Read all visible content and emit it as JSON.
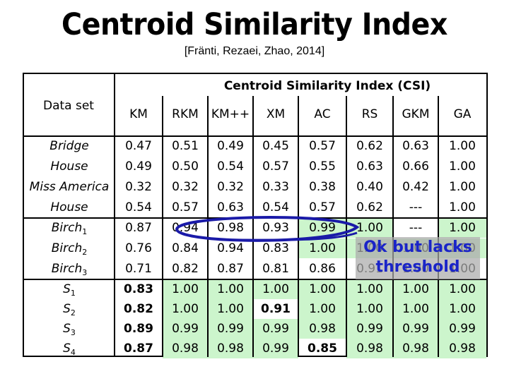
{
  "title": "Centroid Similarity Index",
  "citation": "[Fränti, Rezaei, Zhao, 2014]",
  "table": {
    "group_header": "Centroid Similarity Index (CSI)",
    "dataset_header": "Data set",
    "columns": [
      "KM",
      "RKM",
      "KM++",
      "XM",
      "AC",
      "RS",
      "GKM",
      "GA"
    ],
    "groups": [
      {
        "rows": [
          {
            "dataset": "Bridge",
            "sub": "",
            "values": [
              "0.47",
              "0.51",
              "0.49",
              "0.45",
              "0.57",
              "0.62",
              "0.63",
              "1.00"
            ]
          },
          {
            "dataset": "House",
            "sub": "",
            "values": [
              "0.49",
              "0.50",
              "0.54",
              "0.57",
              "0.55",
              "0.63",
              "0.66",
              "1.00"
            ]
          },
          {
            "dataset": "Miss America",
            "sub": "",
            "values": [
              "0.32",
              "0.32",
              "0.32",
              "0.33",
              "0.38",
              "0.40",
              "0.42",
              "1.00"
            ]
          },
          {
            "dataset": "House",
            "sub": "",
            "values": [
              "0.54",
              "0.57",
              "0.63",
              "0.54",
              "0.57",
              "0.62",
              "---",
              "1.00"
            ]
          }
        ]
      },
      {
        "rows": [
          {
            "dataset": "Birch",
            "sub": "1",
            "values": [
              "0.87",
              "0.94",
              "0.98",
              "0.93",
              "0.99",
              "1.00",
              "---",
              "1.00"
            ]
          },
          {
            "dataset": "Birch",
            "sub": "2",
            "values": [
              "0.76",
              "0.84",
              "0.94",
              "0.83",
              "1.00",
              "1.00",
              "1.00",
              "1.00"
            ]
          },
          {
            "dataset": "Birch",
            "sub": "3",
            "values": [
              "0.71",
              "0.82",
              "0.87",
              "0.81",
              "0.86",
              "0.91",
              "1.00",
              "1.00"
            ]
          }
        ]
      },
      {
        "rows": [
          {
            "dataset": "S",
            "sub": "1",
            "values": [
              "0.83",
              "1.00",
              "1.00",
              "1.00",
              "1.00",
              "1.00",
              "1.00",
              "1.00"
            ]
          },
          {
            "dataset": "S",
            "sub": "2",
            "values": [
              "0.82",
              "1.00",
              "1.00",
              "0.91",
              "1.00",
              "1.00",
              "1.00",
              "1.00"
            ]
          },
          {
            "dataset": "S",
            "sub": "3",
            "values": [
              "0.89",
              "0.99",
              "0.99",
              "0.99",
              "0.98",
              "0.99",
              "0.99",
              "0.99"
            ]
          },
          {
            "dataset": "S",
            "sub": "4",
            "values": [
              "0.87",
              "0.98",
              "0.98",
              "0.99",
              "0.85",
              "0.98",
              "0.98",
              "0.98"
            ]
          }
        ]
      }
    ],
    "highlight_color": "#ccf5cc",
    "green_cells": [
      [
        4,
        4
      ],
      [
        4,
        5
      ],
      [
        4,
        7
      ],
      [
        5,
        4
      ],
      [
        5,
        5
      ],
      [
        5,
        6
      ],
      [
        5,
        7
      ],
      [
        7,
        1
      ],
      [
        7,
        2
      ],
      [
        7,
        3
      ],
      [
        7,
        4
      ],
      [
        7,
        5
      ],
      [
        7,
        6
      ],
      [
        7,
        7
      ],
      [
        8,
        1
      ],
      [
        8,
        2
      ],
      [
        8,
        4
      ],
      [
        8,
        5
      ],
      [
        8,
        6
      ],
      [
        8,
        7
      ],
      [
        9,
        1
      ],
      [
        9,
        2
      ],
      [
        9,
        3
      ],
      [
        9,
        4
      ],
      [
        9,
        5
      ],
      [
        9,
        6
      ],
      [
        9,
        7
      ],
      [
        10,
        1
      ],
      [
        10,
        2
      ],
      [
        10,
        3
      ],
      [
        10,
        5
      ],
      [
        10,
        6
      ],
      [
        10,
        7
      ]
    ],
    "bold_cells": [
      [
        7,
        0
      ],
      [
        8,
        0
      ],
      [
        9,
        0
      ],
      [
        10,
        0
      ],
      [
        8,
        3
      ],
      [
        10,
        4
      ]
    ]
  },
  "annotation": {
    "text_line1": "Ok but lacks",
    "text_line2": "threshold",
    "color": "#1a24c8"
  }
}
